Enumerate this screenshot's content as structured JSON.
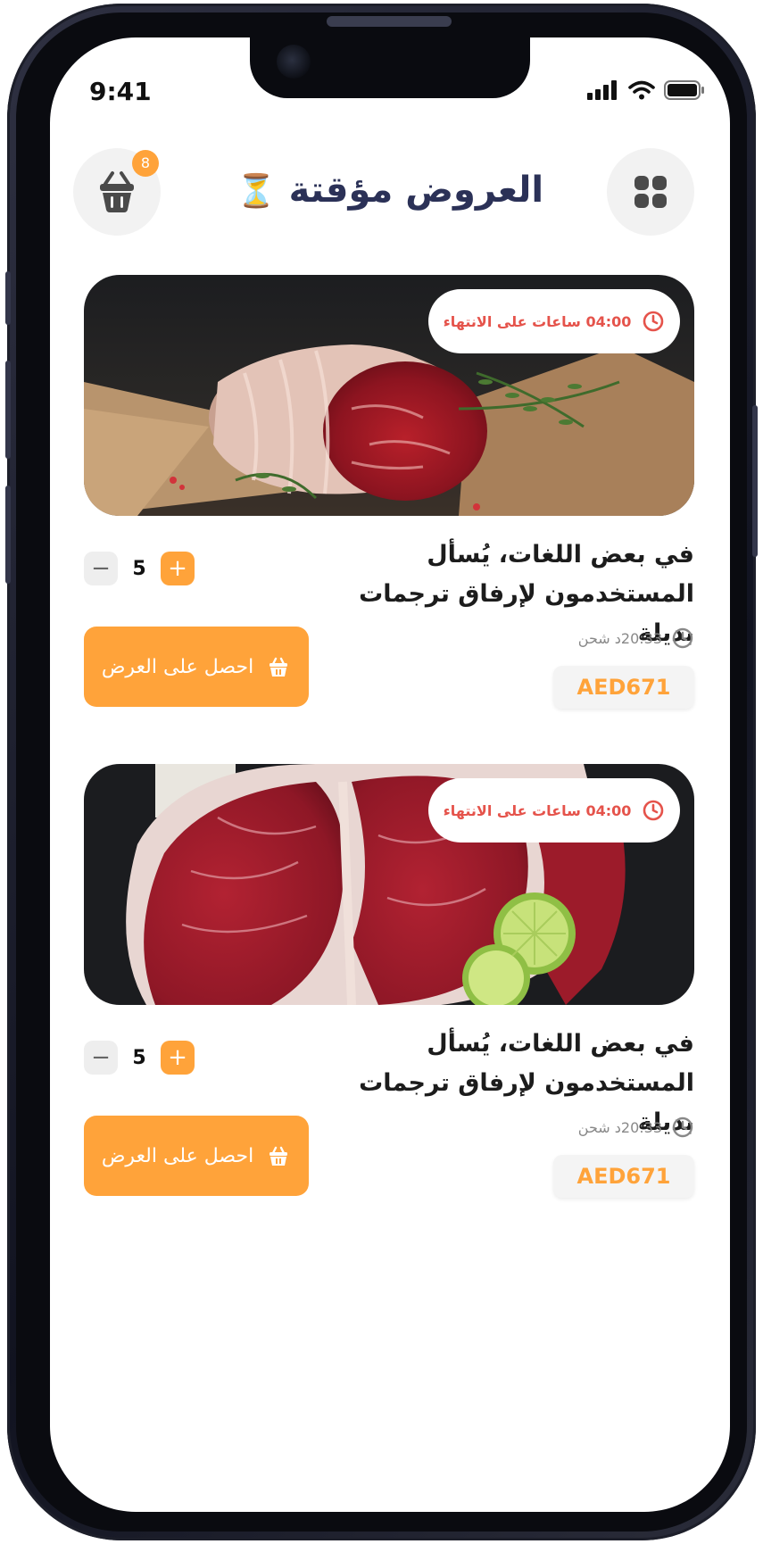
{
  "status_bar": {
    "time": "9:41"
  },
  "header": {
    "title": "العروض مؤقتة",
    "title_emoji": "⏳",
    "cart_count": "8",
    "cart_icon": "basket-icon",
    "menu_icon": "grid-icon"
  },
  "colors": {
    "accent": "#ffa33a",
    "title": "#2b3157",
    "timer": "#e5534b"
  },
  "offers": [
    {
      "timer": "04:00 ساعات على الانتهاء",
      "image": "roast-beef-photo",
      "description": "في بعض اللغات، يُسأل المستخدمون لإرفاق ترجمات بديلة",
      "shipping": "20:33د شحن",
      "price": "AED671",
      "quantity": "5",
      "cta": "احصل على العرض"
    },
    {
      "timer": "04:00 ساعات على الانتهاء",
      "image": "tbone-steak-photo",
      "description": "في بعض اللغات، يُسأل المستخدمون لإرفاق ترجمات بديلة",
      "shipping": "20:33د شحن",
      "price": "AED671",
      "quantity": "5",
      "cta": "احصل على العرض"
    }
  ]
}
